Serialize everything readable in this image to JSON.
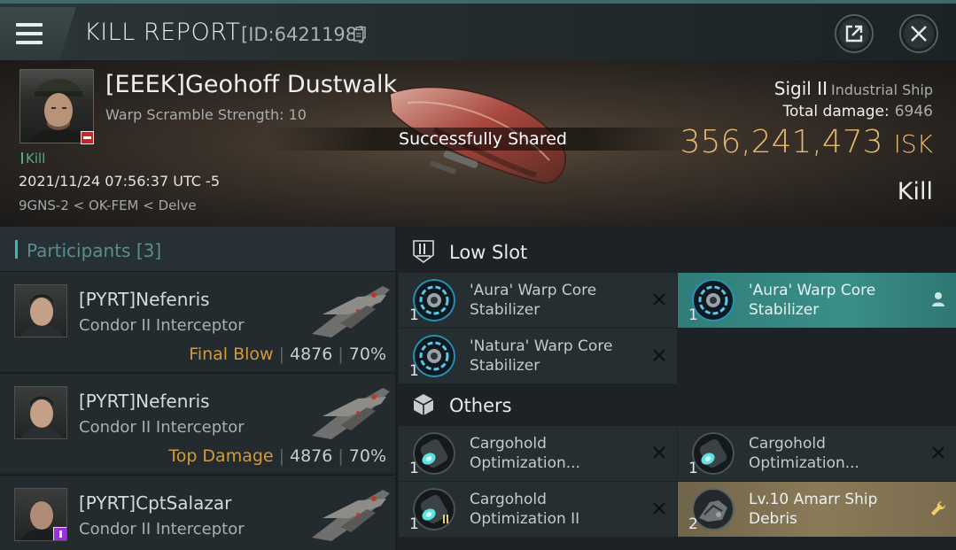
{
  "header": {
    "title": "KILL REPORT",
    "report_id": "[ID:6421198]"
  },
  "victim": {
    "name": "[EEEK]Geohoff Dustwalk",
    "warp_scramble": "Warp Scramble Strength: 10",
    "kill_tag": "Kill",
    "datetime": "2021/11/24 07:56:37 UTC -5",
    "location": "9GNS-2 < OK-FEM < Delve",
    "shared_message": "Successfully Shared",
    "ship_name": "Sigil II",
    "ship_class": "Industrial Ship",
    "total_damage_label": "Total damage:",
    "total_damage": "6946",
    "isk_value": "356,241,473",
    "isk_unit": "ISK",
    "result": "Kill"
  },
  "participants": {
    "label": "Participants",
    "count": "[3]",
    "rows": [
      {
        "name": "[PYRT]Nefenris",
        "ship": "Condor II Interceptor",
        "tag": "Final Blow",
        "damage": "4876",
        "percent": "70%"
      },
      {
        "name": "[PYRT]Nefenris",
        "ship": "Condor II Interceptor",
        "tag": "Top Damage",
        "damage": "4876",
        "percent": "70%"
      },
      {
        "name": "[PYRT]CptSalazar",
        "ship": "Condor II Interceptor",
        "tag": "",
        "damage": "",
        "percent": ""
      }
    ]
  },
  "items": {
    "low_slot": {
      "label": "Low Slot",
      "entries": [
        {
          "qty": "1",
          "name": "'Aura' Warp Core Stabilizer",
          "status": "destroyed"
        },
        {
          "qty": "1",
          "name": "'Aura' Warp Core Stabilizer",
          "status": "dropped"
        },
        {
          "qty": "1",
          "name": "'Natura' Warp Core Stabilizer",
          "status": "destroyed"
        }
      ]
    },
    "others": {
      "label": "Others",
      "entries": [
        {
          "qty": "1",
          "name": "Cargohold Optimization...",
          "status": "destroyed"
        },
        {
          "qty": "1",
          "name": "Cargohold Optimization...",
          "status": "destroyed"
        },
        {
          "qty": "1",
          "name": "Cargohold Optimization II",
          "status": "destroyed"
        },
        {
          "qty": "2",
          "name": "Lv.10 Amarr Ship Debris",
          "status": "salvage"
        }
      ]
    }
  },
  "colors": {
    "isk": "#e4b86e",
    "accent": "#3fb6ba",
    "kill": "#4fb07a",
    "final_blow": "#d49a3c",
    "dropped": "#3a8f89"
  }
}
